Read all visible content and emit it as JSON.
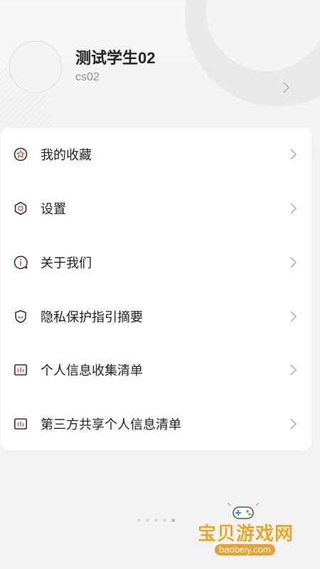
{
  "profile": {
    "name": "测试学生02",
    "id": "cs02"
  },
  "menu": {
    "items": [
      {
        "label": "我的收藏",
        "icon": "star-badge-icon"
      },
      {
        "label": "设置",
        "icon": "gear-hexagon-icon"
      },
      {
        "label": "关于我们",
        "icon": "info-bubble-icon"
      },
      {
        "label": "隐私保护指引摘要",
        "icon": "shield-icon"
      },
      {
        "label": "个人信息收集清单",
        "icon": "bar-chart-icon"
      },
      {
        "label": "第三方共享个人信息清单",
        "icon": "bar-chart-icon"
      }
    ]
  },
  "pager": {
    "count": 5,
    "active_index": 4
  },
  "watermark": {
    "title": "宝贝游戏网",
    "url": "baobeiy.com"
  },
  "colors": {
    "icon_accent": "#e0633a",
    "icon_stroke": "#333333",
    "watermark": "#f0a227"
  }
}
